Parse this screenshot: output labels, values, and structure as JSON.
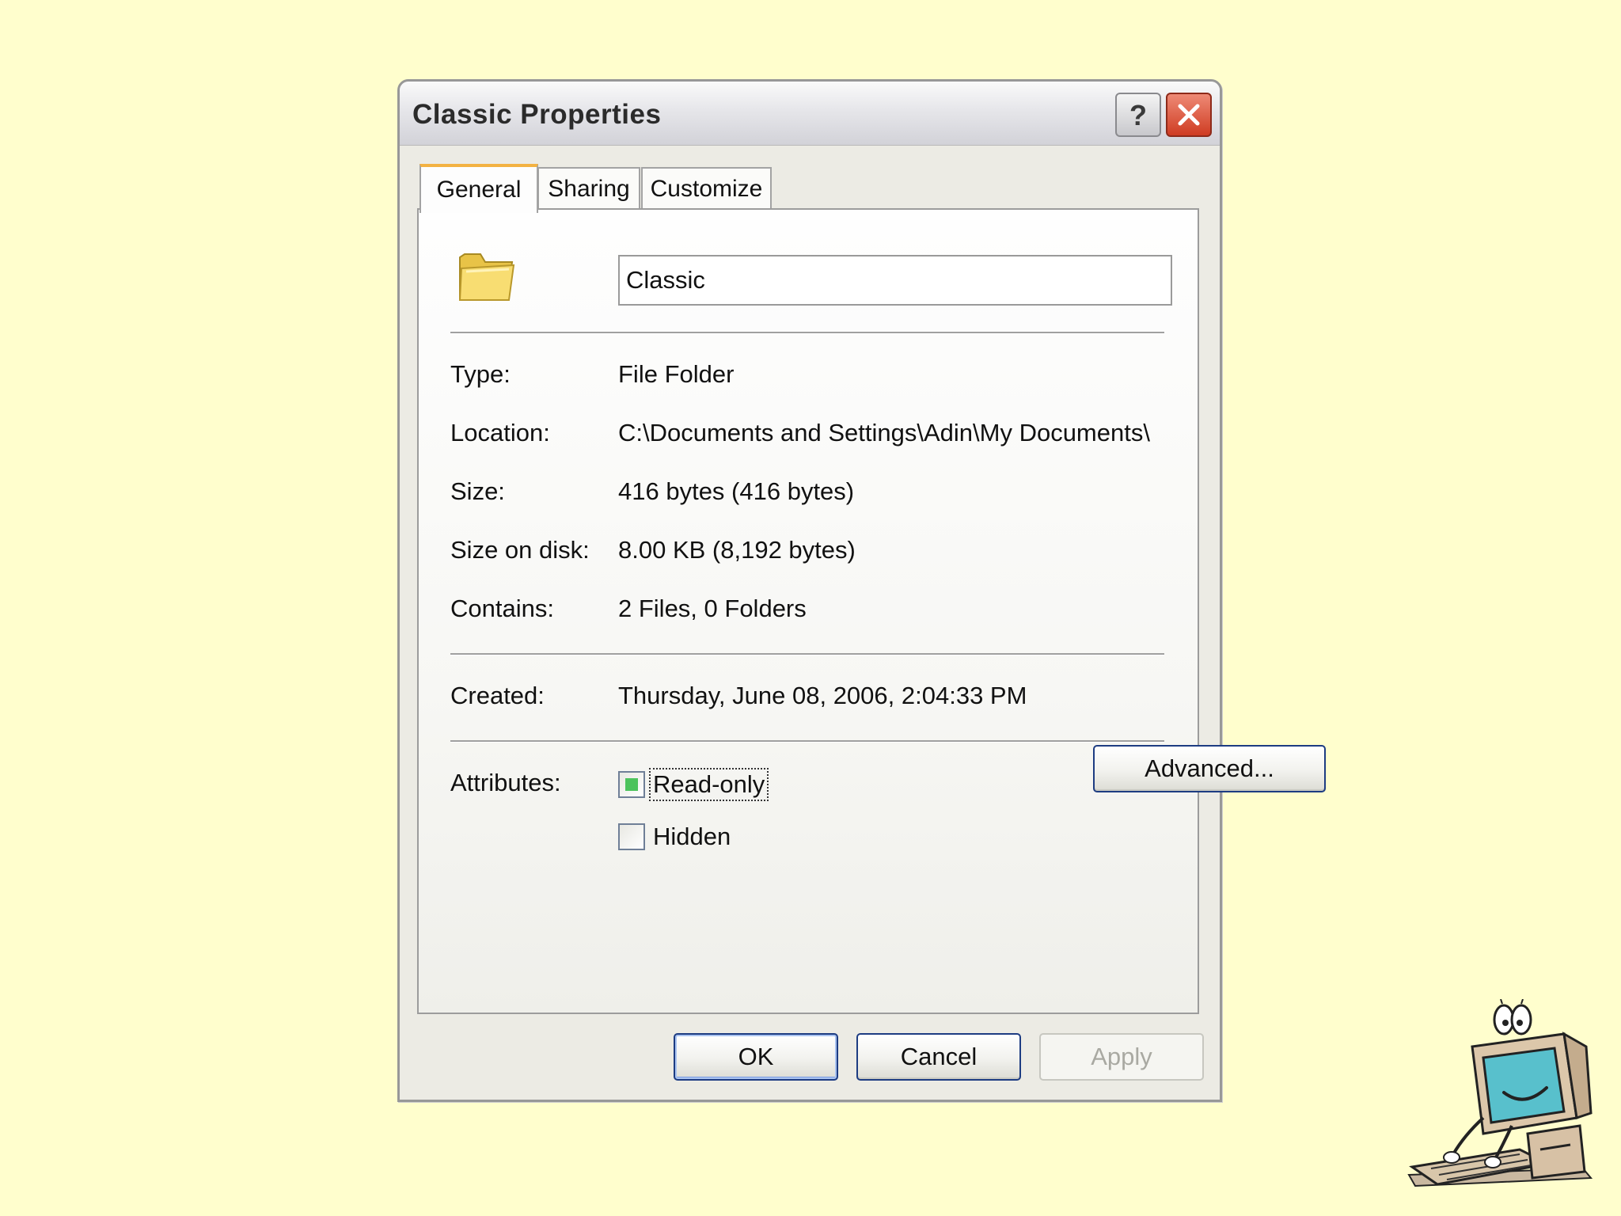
{
  "dialog": {
    "title": "Classic Properties",
    "help_button": "?",
    "close_button": "✕"
  },
  "tabs": [
    {
      "label": "General",
      "selected": true
    },
    {
      "label": "Sharing",
      "selected": false
    },
    {
      "label": "Customize",
      "selected": false
    }
  ],
  "general": {
    "folder_name": "Classic",
    "type_label": "Type:",
    "type_value": "File Folder",
    "location_label": "Location:",
    "location_value": "C:\\Documents and Settings\\Adin\\My Documents\\",
    "size_label": "Size:",
    "size_value": "416 bytes (416 bytes)",
    "size_on_disk_label": "Size on disk:",
    "size_on_disk_value": "8.00 KB (8,192 bytes)",
    "contains_label": "Contains:",
    "contains_value": "2 Files, 0 Folders",
    "created_label": "Created:",
    "created_value": "Thursday, June 08, 2006, 2:04:33 PM",
    "attributes_label": "Attributes:",
    "readonly_label": "Read-only",
    "readonly_state": "mixed",
    "hidden_label": "Hidden",
    "hidden_checked": false,
    "advanced_button": "Advanced..."
  },
  "buttons": {
    "ok": "OK",
    "cancel": "Cancel",
    "apply": "Apply"
  },
  "colors": {
    "background": "#fffecd",
    "dialog_face": "#ecebe4",
    "selected_tab_accent": "#f3b242",
    "button_border": "#1d3c82",
    "close_button": "#cf3c22",
    "checkbox_mixed": "#4cc35c"
  },
  "icons": {
    "folder": "folder-icon",
    "help": "help-icon",
    "close": "close-icon",
    "clipart": "computer-character-clipart"
  }
}
